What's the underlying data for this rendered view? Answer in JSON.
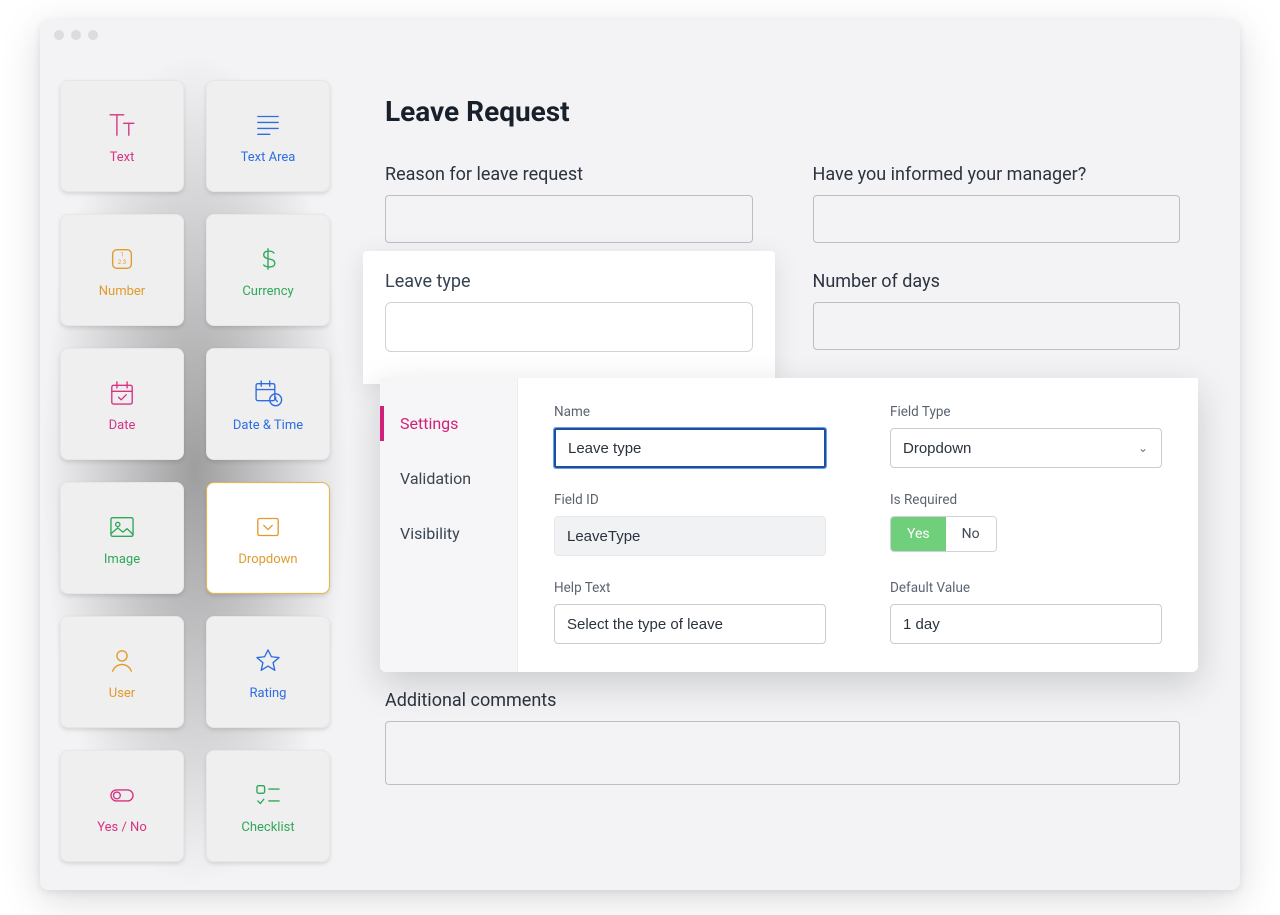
{
  "palette": [
    {
      "key": "text",
      "label": "Text",
      "color": "pink",
      "icon": "text"
    },
    {
      "key": "textarea",
      "label": "Text Area",
      "color": "blue",
      "icon": "textarea"
    },
    {
      "key": "number",
      "label": "Number",
      "color": "orange",
      "icon": "number"
    },
    {
      "key": "currency",
      "label": "Currency",
      "color": "green",
      "icon": "currency"
    },
    {
      "key": "date",
      "label": "Date",
      "color": "pink",
      "icon": "date"
    },
    {
      "key": "datetime",
      "label": "Date & Time",
      "color": "blue",
      "icon": "datetime"
    },
    {
      "key": "image",
      "label": "Image",
      "color": "green",
      "icon": "image"
    },
    {
      "key": "dropdown",
      "label": "Dropdown",
      "color": "orange",
      "icon": "dropdown",
      "selected": true
    },
    {
      "key": "user",
      "label": "User",
      "color": "orange",
      "icon": "user"
    },
    {
      "key": "rating",
      "label": "Rating",
      "color": "blue",
      "icon": "rating"
    },
    {
      "key": "yesno",
      "label": "Yes / No",
      "color": "pink",
      "icon": "yesno"
    },
    {
      "key": "checklist",
      "label": "Checklist",
      "color": "green",
      "icon": "checklist"
    }
  ],
  "form": {
    "title": "Leave Request",
    "fields": {
      "reason": {
        "label": "Reason for leave request"
      },
      "informed": {
        "label": "Have you informed your manager?"
      },
      "leavetype": {
        "label": "Leave type"
      },
      "days": {
        "label": "Number of days"
      },
      "comments": {
        "label": "Additional comments"
      }
    }
  },
  "panel": {
    "tabs": {
      "settings": "Settings",
      "validation": "Validation",
      "visibility": "Visibility"
    },
    "fields": {
      "name": {
        "label": "Name",
        "value": "Leave type"
      },
      "fieldType": {
        "label": "Field Type",
        "value": "Dropdown"
      },
      "fieldId": {
        "label": "Field ID",
        "value": "LeaveType"
      },
      "isRequired": {
        "label": "Is Required",
        "yes": "Yes",
        "no": "No"
      },
      "helpText": {
        "label": "Help Text",
        "value": "Select the type of leave"
      },
      "defaultValue": {
        "label": "Default Value",
        "value": "1 day"
      }
    }
  }
}
